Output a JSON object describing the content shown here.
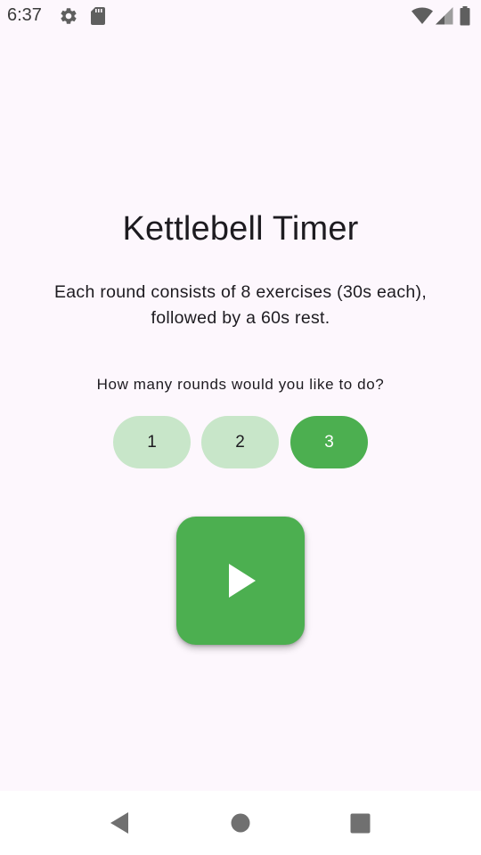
{
  "status_bar": {
    "time": "6:37",
    "left_icons": [
      "gear-icon",
      "sd-card-icon"
    ],
    "right_icons": [
      "wifi-icon",
      "cell-signal-icon",
      "battery-icon"
    ]
  },
  "main": {
    "title": "Kettlebell Timer",
    "description": "Each round consists of 8 exercises (30s each), followed by a 60s rest.",
    "question": "How many rounds would you like to do?",
    "rounds": [
      {
        "label": "1",
        "selected": false
      },
      {
        "label": "2",
        "selected": false
      },
      {
        "label": "3",
        "selected": true
      }
    ],
    "play_button_icon": "play-icon"
  },
  "nav_bar": {
    "icons": [
      "back-icon",
      "home-icon",
      "recents-icon"
    ]
  },
  "colors": {
    "background": "#fdf7fd",
    "accent": "#4caf50",
    "accent_light": "#c8e6c9",
    "text": "#1d1b20"
  }
}
